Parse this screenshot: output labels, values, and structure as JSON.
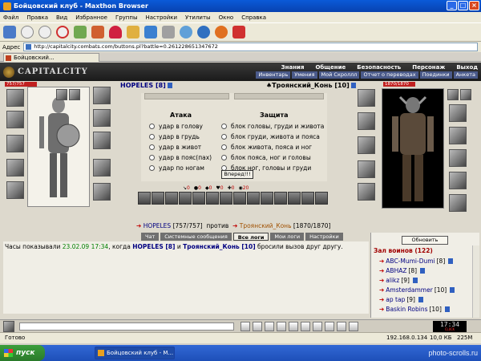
{
  "window": {
    "title": "Бойцовский клуб - Maxthon Browser"
  },
  "menu": [
    "Файл",
    "Правка",
    "Вид",
    "Избранное",
    "Группы",
    "Настройки",
    "Утилиты",
    "Окно",
    "Справка"
  ],
  "address": {
    "label": "Адрес",
    "url": "http://capitalcity.combats.com/buttons.pl?battle=0.261228651347672"
  },
  "tab": {
    "label": "Бойцовский..."
  },
  "game": {
    "logo": "CAPITALCITY",
    "topnav": [
      "Знания",
      "Общение",
      "Безопасность",
      "Персонаж",
      "Выход"
    ],
    "subnav": [
      "Инвентарь",
      "Умения",
      "Мой Скроллл",
      "Отчет о переводах",
      "Поединки",
      "Анкета"
    ],
    "player": {
      "name": "HOPELES",
      "level": "[8]",
      "hp": "757/757"
    },
    "enemy": {
      "name": "Троянский_Конь",
      "level": "[10]",
      "hp": "1870/1870"
    },
    "attack_title": "Атака",
    "defense_title": "Защита",
    "attacks": [
      "удар в голову",
      "удар в грудь",
      "удар в живот",
      "удар в пояс(пах)",
      "удар по ногам"
    ],
    "defenses": [
      "блок головы, груди и живота",
      "блок груди, живота и пояса",
      "блок живота, пояса и ног",
      "блок пояса, ног и головы",
      "блок ног, головы и груди"
    ],
    "go_button": "Вперед!!!",
    "stats": [
      {
        "label": "↘",
        "value": "0"
      },
      {
        "label": "●",
        "value": "0"
      },
      {
        "label": "◆",
        "value": "0"
      },
      {
        "label": "♥",
        "value": "0"
      },
      {
        "label": "✚",
        "value": "0"
      },
      {
        "label": "◉",
        "value": "20"
      }
    ],
    "versus": {
      "p1": "HOPELES",
      "p1_hp": "[757/757]",
      "word": "против",
      "p2": "Троянский_Конь",
      "p2_hp": "[1870/1870]"
    },
    "chat_tabs": [
      "Чат",
      "Системные сообщения",
      "Все логи",
      "Мои логи",
      "Настройки"
    ],
    "chat": {
      "prefix": "Часы показывали",
      "timestamp": "23.02.09 17:34",
      "text1": ", когда",
      "p1": "HOPELES [8]",
      "and": "и",
      "p2": "Троянский_Конь [10]",
      "text2": "бросили вызов друг другу."
    },
    "hall": {
      "refresh": "Обновить",
      "title": "Зал воинов (122)",
      "warriors": [
        {
          "name": "ABC-Mumi-Dumi",
          "level": "[8]"
        },
        {
          "name": "ABHAZ",
          "level": "[8]"
        },
        {
          "name": "alikz",
          "level": "[9]"
        },
        {
          "name": "Amsterdammer",
          "level": "[10]"
        },
        {
          "name": "ap tap",
          "level": "[9]"
        },
        {
          "name": "Baskin Robins",
          "level": "[10]"
        }
      ]
    }
  },
  "clock": {
    "time": "17:34",
    "caption": "CLOCK"
  },
  "status": {
    "ready": "Готово",
    "ip": "192.168.0.134",
    "speed": "10,0 КБ",
    "mem": "225M"
  },
  "taskbar": {
    "start": "пуск",
    "task": "Бойцовский клуб - М...",
    "watermark": "photo-scrolls.ru"
  }
}
